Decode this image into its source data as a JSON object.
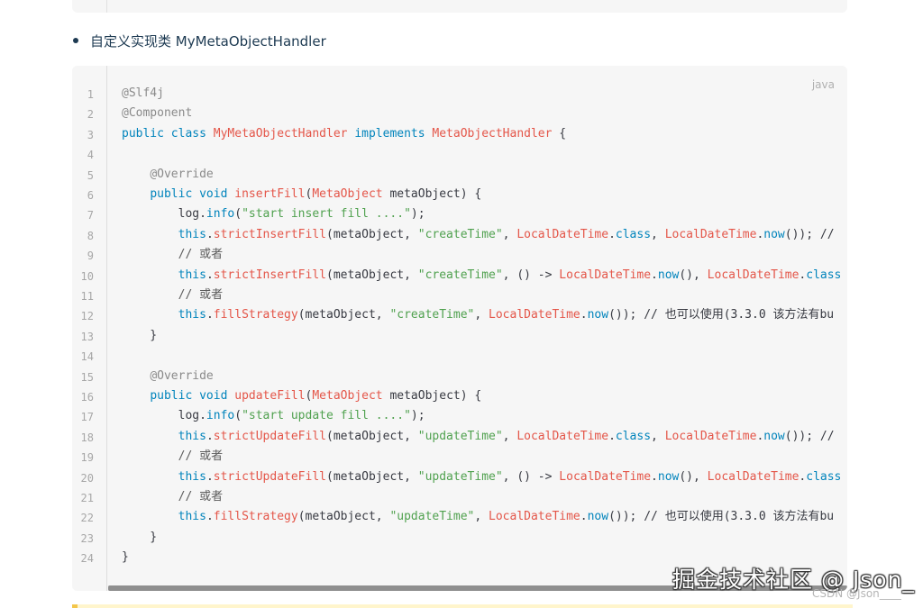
{
  "bullet": {
    "text": "自定义实现类 MyMetaObjectHandler"
  },
  "code_block": {
    "language": "java",
    "line_numbers": [
      "1",
      "2",
      "3",
      "4",
      "5",
      "6",
      "7",
      "8",
      "9",
      "10",
      "11",
      "12",
      "13",
      "14",
      "15",
      "16",
      "17",
      "18",
      "19",
      "20",
      "21",
      "22",
      "23",
      "24"
    ],
    "lines": [
      [
        [
          "anno",
          "@Slf4j"
        ]
      ],
      [
        [
          "anno",
          "@Component"
        ]
      ],
      [
        [
          "kw",
          "public "
        ],
        [
          "kw",
          "class "
        ],
        [
          "type",
          "MyMetaObjectHandler "
        ],
        [
          "kw",
          "implements "
        ],
        [
          "type",
          "MetaObjectHandler "
        ],
        [
          "plain",
          "{"
        ]
      ],
      [],
      [
        [
          "plain",
          "    "
        ],
        [
          "anno",
          "@Override"
        ]
      ],
      [
        [
          "plain",
          "    "
        ],
        [
          "kw",
          "public "
        ],
        [
          "kw",
          "void "
        ],
        [
          "fn",
          "insertFill"
        ],
        [
          "plain",
          "("
        ],
        [
          "type",
          "MetaObject "
        ],
        [
          "plain",
          "metaObject) {"
        ]
      ],
      [
        [
          "plain",
          "        log."
        ],
        [
          "kw",
          "info"
        ],
        [
          "plain",
          "("
        ],
        [
          "str",
          "\"start insert fill ....\""
        ],
        [
          "plain",
          ");"
        ]
      ],
      [
        [
          "plain",
          "        "
        ],
        [
          "kw",
          "this"
        ],
        [
          "plain",
          "."
        ],
        [
          "fn",
          "strictInsertFill"
        ],
        [
          "plain",
          "(metaObject, "
        ],
        [
          "str",
          "\"createTime\""
        ],
        [
          "plain",
          ", "
        ],
        [
          "type",
          "LocalDateTime"
        ],
        [
          "plain",
          "."
        ],
        [
          "kw",
          "class"
        ],
        [
          "plain",
          ", "
        ],
        [
          "type",
          "LocalDateTime"
        ],
        [
          "plain",
          "."
        ],
        [
          "kw",
          "now"
        ],
        [
          "plain",
          "()); // "
        ]
      ],
      [
        [
          "plain",
          "        "
        ],
        [
          "cm",
          "// 或者"
        ]
      ],
      [
        [
          "plain",
          "        "
        ],
        [
          "kw",
          "this"
        ],
        [
          "plain",
          "."
        ],
        [
          "fn",
          "strictInsertFill"
        ],
        [
          "plain",
          "(metaObject, "
        ],
        [
          "str",
          "\"createTime\""
        ],
        [
          "plain",
          ", () -> "
        ],
        [
          "type",
          "LocalDateTime"
        ],
        [
          "plain",
          "."
        ],
        [
          "kw",
          "now"
        ],
        [
          "plain",
          "(), "
        ],
        [
          "type",
          "LocalDateTime"
        ],
        [
          "plain",
          "."
        ],
        [
          "kw",
          "class"
        ]
      ],
      [
        [
          "plain",
          "        "
        ],
        [
          "cm",
          "// 或者"
        ]
      ],
      [
        [
          "plain",
          "        "
        ],
        [
          "kw",
          "this"
        ],
        [
          "plain",
          "."
        ],
        [
          "fn",
          "fillStrategy"
        ],
        [
          "plain",
          "(metaObject, "
        ],
        [
          "str",
          "\"createTime\""
        ],
        [
          "plain",
          ", "
        ],
        [
          "type",
          "LocalDateTime"
        ],
        [
          "plain",
          "."
        ],
        [
          "kw",
          "now"
        ],
        [
          "plain",
          "()); // 也可以使用(3.3.0 该方法有bu"
        ]
      ],
      [
        [
          "plain",
          "    }"
        ]
      ],
      [],
      [
        [
          "plain",
          "    "
        ],
        [
          "anno",
          "@Override"
        ]
      ],
      [
        [
          "plain",
          "    "
        ],
        [
          "kw",
          "public "
        ],
        [
          "kw",
          "void "
        ],
        [
          "fn",
          "updateFill"
        ],
        [
          "plain",
          "("
        ],
        [
          "type",
          "MetaObject "
        ],
        [
          "plain",
          "metaObject) {"
        ]
      ],
      [
        [
          "plain",
          "        log."
        ],
        [
          "kw",
          "info"
        ],
        [
          "plain",
          "("
        ],
        [
          "str",
          "\"start update fill ....\""
        ],
        [
          "plain",
          ");"
        ]
      ],
      [
        [
          "plain",
          "        "
        ],
        [
          "kw",
          "this"
        ],
        [
          "plain",
          "."
        ],
        [
          "fn",
          "strictUpdateFill"
        ],
        [
          "plain",
          "(metaObject, "
        ],
        [
          "str",
          "\"updateTime\""
        ],
        [
          "plain",
          ", "
        ],
        [
          "type",
          "LocalDateTime"
        ],
        [
          "plain",
          "."
        ],
        [
          "kw",
          "class"
        ],
        [
          "plain",
          ", "
        ],
        [
          "type",
          "LocalDateTime"
        ],
        [
          "plain",
          "."
        ],
        [
          "kw",
          "now"
        ],
        [
          "plain",
          "()); // "
        ]
      ],
      [
        [
          "plain",
          "        "
        ],
        [
          "cm",
          "// 或者"
        ]
      ],
      [
        [
          "plain",
          "        "
        ],
        [
          "kw",
          "this"
        ],
        [
          "plain",
          "."
        ],
        [
          "fn",
          "strictUpdateFill"
        ],
        [
          "plain",
          "(metaObject, "
        ],
        [
          "str",
          "\"updateTime\""
        ],
        [
          "plain",
          ", () -> "
        ],
        [
          "type",
          "LocalDateTime"
        ],
        [
          "plain",
          "."
        ],
        [
          "kw",
          "now"
        ],
        [
          "plain",
          "(), "
        ],
        [
          "type",
          "LocalDateTime"
        ],
        [
          "plain",
          "."
        ],
        [
          "kw",
          "class"
        ]
      ],
      [
        [
          "plain",
          "        "
        ],
        [
          "cm",
          "// 或者"
        ]
      ],
      [
        [
          "plain",
          "        "
        ],
        [
          "kw",
          "this"
        ],
        [
          "plain",
          "."
        ],
        [
          "fn",
          "fillStrategy"
        ],
        [
          "plain",
          "(metaObject, "
        ],
        [
          "str",
          "\"updateTime\""
        ],
        [
          "plain",
          ", "
        ],
        [
          "type",
          "LocalDateTime"
        ],
        [
          "plain",
          "."
        ],
        [
          "kw",
          "now"
        ],
        [
          "plain",
          "()); // 也可以使用(3.3.0 该方法有bu"
        ]
      ],
      [
        [
          "plain",
          "    }"
        ]
      ],
      [
        [
          "plain",
          "}"
        ]
      ]
    ]
  },
  "watermark": {
    "text": "掘金技术社区 @ Json_"
  },
  "csdn_mark": {
    "text": "CSDN @Json____"
  }
}
